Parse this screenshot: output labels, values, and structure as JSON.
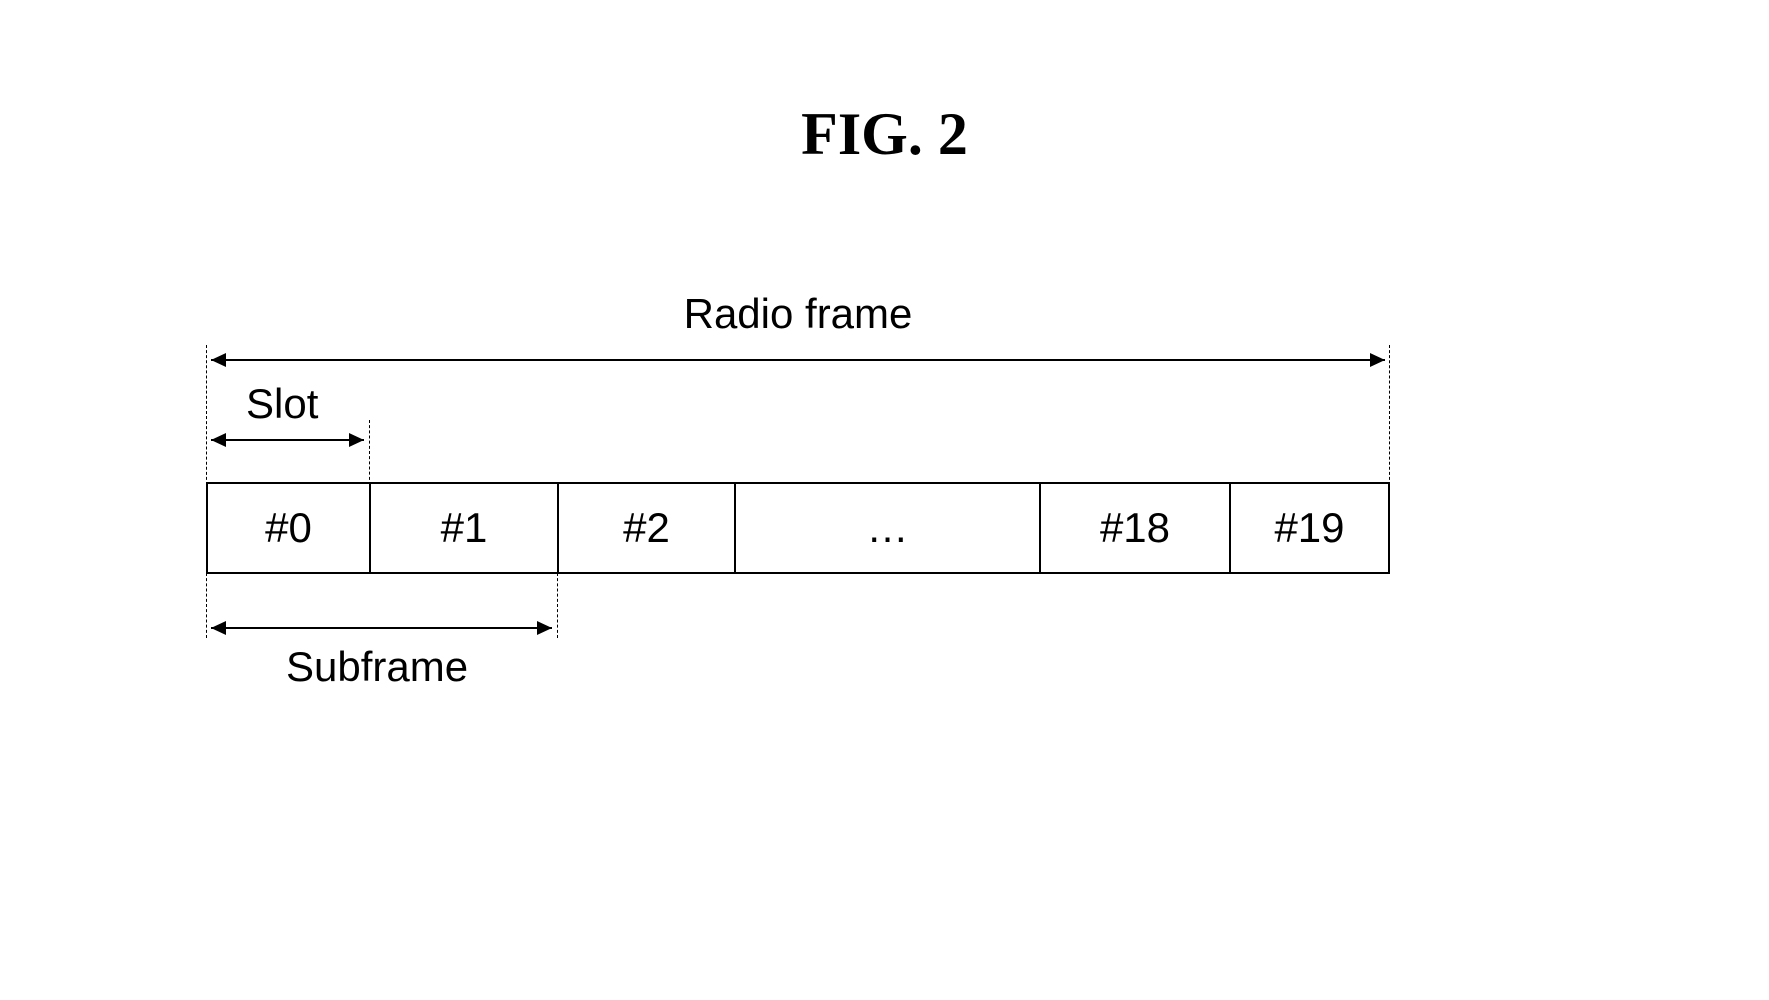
{
  "figure_title": "FIG. 2",
  "labels": {
    "radio_frame": "Radio frame",
    "slot": "Slot",
    "subframe": "Subframe"
  },
  "slots": {
    "cell0": "#0",
    "cell1": "#1",
    "cell2": "#2",
    "cell3": "…",
    "cell4": "#18",
    "cell5": "#19"
  },
  "chart_data": {
    "type": "diagram",
    "description": "Radio frame structure showing a frame divided into 20 slots (numbered #0 to #19), where 2 slots form 1 subframe. The radio frame spans the full width.",
    "total_slots": 20,
    "slots_per_subframe": 2,
    "visible_slot_labels": [
      "#0",
      "#1",
      "#2",
      "…",
      "#18",
      "#19"
    ]
  }
}
